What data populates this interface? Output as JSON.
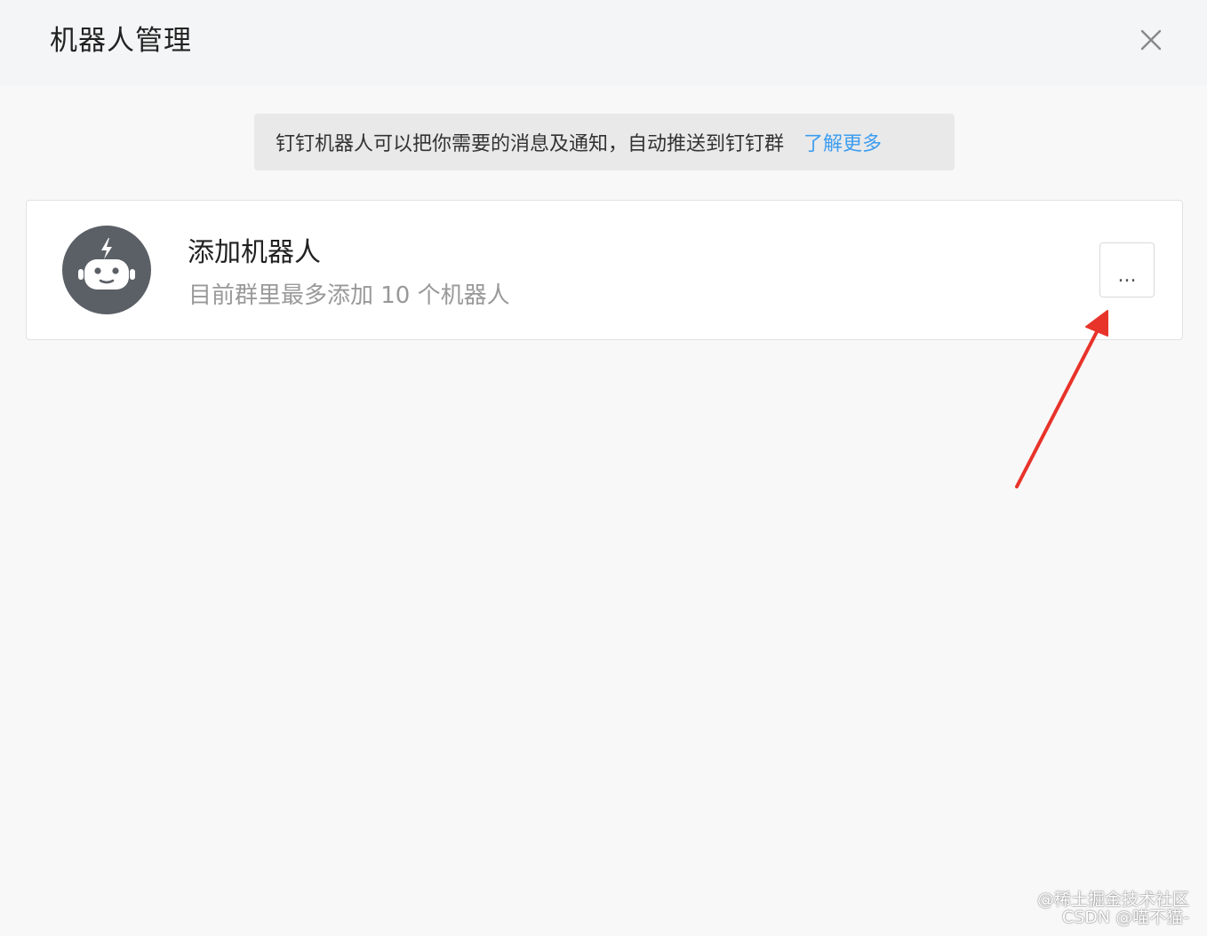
{
  "dialog": {
    "title": "机器人管理"
  },
  "notice": {
    "text": "钉钉机器人可以把你需要的消息及通知，自动推送到钉钉群",
    "link": "了解更多",
    "link_color": "#3d9df0"
  },
  "card": {
    "title": "添加机器人",
    "subtitle": "目前群里最多添加 10 个机器人",
    "more_label": "...",
    "avatar_icon": "robot-icon"
  },
  "annotation": {
    "arrow_color": "#e8332a"
  },
  "watermark": {
    "line1": "@稀土掘金技术社区",
    "line2": "CSDN @喵不猫-"
  }
}
